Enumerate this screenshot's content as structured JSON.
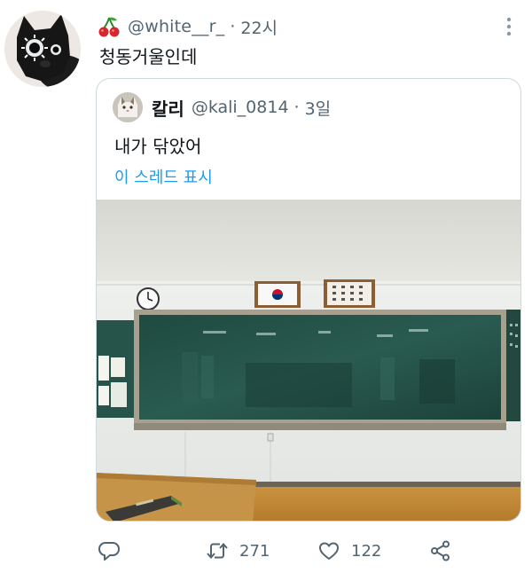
{
  "tweet": {
    "handle": "@white__r_",
    "separator": "·",
    "time": "22시",
    "text": "청동거울인데",
    "avatar_icon": "black-cat-avatar",
    "header_icon": "cherry-icon"
  },
  "quote": {
    "name": "칼리",
    "handle": "@kali_0814",
    "separator": "·",
    "time": "3일",
    "text": "내가 닦았어",
    "thread_link": "이 스레드 표시",
    "link_color": "#1d9bf0",
    "avatar_icon": "cat-avatar",
    "photo": "classroom-blackboard-photo"
  },
  "actions": {
    "reply_icon": "reply-icon",
    "retweet_icon": "retweet-icon",
    "retweet_count": "271",
    "like_icon": "heart-icon",
    "like_count": "122",
    "share_icon": "share-icon"
  },
  "colors": {
    "text": "#0f1419",
    "secondary": "#536471",
    "border": "#cfd9de"
  }
}
